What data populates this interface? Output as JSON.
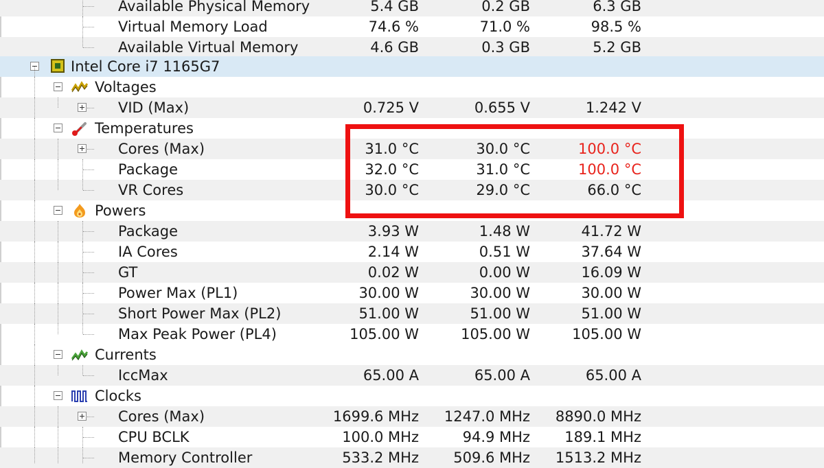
{
  "rows": [
    {
      "label": "Available Physical Memory",
      "values": [
        "5.4 GB",
        "0.2 GB",
        "6.3 GB"
      ],
      "alt": true
    },
    {
      "label": "Virtual Memory Load",
      "values": [
        "74.6 %",
        "71.0 %",
        "98.5 %"
      ]
    },
    {
      "label": "Available Virtual Memory",
      "values": [
        "4.6 GB",
        "0.3 GB",
        "5.2 GB"
      ],
      "alt": true
    },
    {
      "label": "Intel Core i7 1165G7",
      "values": []
    },
    {
      "label": "Voltages",
      "values": []
    },
    {
      "label": "VID (Max)",
      "values": [
        "0.725 V",
        "0.655 V",
        "1.242 V"
      ],
      "alt": true
    },
    {
      "label": "Temperatures",
      "values": []
    },
    {
      "label": "Cores (Max)",
      "values": [
        "31.0 °C",
        "30.0 °C",
        "100.0 °C"
      ],
      "alt": true
    },
    {
      "label": "Package",
      "values": [
        "32.0 °C",
        "31.0 °C",
        "100.0 °C"
      ]
    },
    {
      "label": "VR Cores",
      "values": [
        "30.0 °C",
        "29.0 °C",
        "66.0 °C"
      ],
      "alt": true
    },
    {
      "label": "Powers",
      "values": []
    },
    {
      "label": "Package",
      "values": [
        "3.93 W",
        "1.48 W",
        "41.72 W"
      ],
      "alt": true
    },
    {
      "label": "IA Cores",
      "values": [
        "2.14 W",
        "0.51 W",
        "37.64 W"
      ]
    },
    {
      "label": "GT",
      "values": [
        "0.02 W",
        "0.00 W",
        "16.09 W"
      ],
      "alt": true
    },
    {
      "label": "Power Max (PL1)",
      "values": [
        "30.00 W",
        "30.00 W",
        "30.00 W"
      ]
    },
    {
      "label": "Short Power Max (PL2)",
      "values": [
        "51.00 W",
        "51.00 W",
        "51.00 W"
      ],
      "alt": true
    },
    {
      "label": "Max Peak Power (PL4)",
      "values": [
        "105.00 W",
        "105.00 W",
        "105.00 W"
      ]
    },
    {
      "label": "Currents",
      "values": []
    },
    {
      "label": "IccMax",
      "values": [
        "65.00 A",
        "65.00 A",
        "65.00 A"
      ],
      "alt": true
    },
    {
      "label": "Clocks",
      "values": []
    },
    {
      "label": "Cores (Max)",
      "values": [
        "1699.6 MHz",
        "1247.0 MHz",
        "8890.0 MHz"
      ],
      "alt": true
    },
    {
      "label": "CPU BCLK",
      "values": [
        "100.0 MHz",
        "94.9 MHz",
        "189.1 MHz"
      ]
    },
    {
      "label": "Memory Controller",
      "values": [
        "533.2 MHz",
        "509.6 MHz",
        "1513.2 MHz"
      ],
      "alt": true
    }
  ],
  "colors": {
    "hot": "#e8231c",
    "highlight": "#ee1111",
    "selected": "#d9e9f5"
  },
  "icons": {
    "cpu": "cpu-chip-icon",
    "voltages": "voltage-wave-icon",
    "temperatures": "thermometer-icon",
    "powers": "power-flame-icon",
    "currents": "current-wave-icon",
    "clocks": "clock-pulse-icon"
  }
}
